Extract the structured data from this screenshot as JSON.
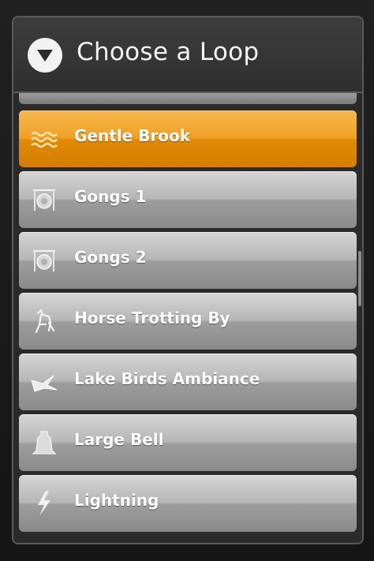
{
  "dialog": {
    "title": "Choose a Loop",
    "header_icon": "chevron-down-circle-icon"
  },
  "loops": [
    {
      "label": "Gentle Brook",
      "icon": "water-waves-icon",
      "selected": true
    },
    {
      "label": "Gongs 1",
      "icon": "gong-icon",
      "selected": false
    },
    {
      "label": "Gongs 2",
      "icon": "gong-icon",
      "selected": false
    },
    {
      "label": "Horse Trotting By",
      "icon": "horse-icon",
      "selected": false
    },
    {
      "label": "Lake Birds Ambiance",
      "icon": "bird-icon",
      "selected": false
    },
    {
      "label": "Large Bell",
      "icon": "bell-icon",
      "selected": false
    },
    {
      "label": "Lightning",
      "icon": "lightning-icon",
      "selected": false
    }
  ],
  "colors": {
    "selected_accent": "#f0a024",
    "item_gray": "#a8a8a8",
    "header_bg": "#3a3a3a"
  }
}
